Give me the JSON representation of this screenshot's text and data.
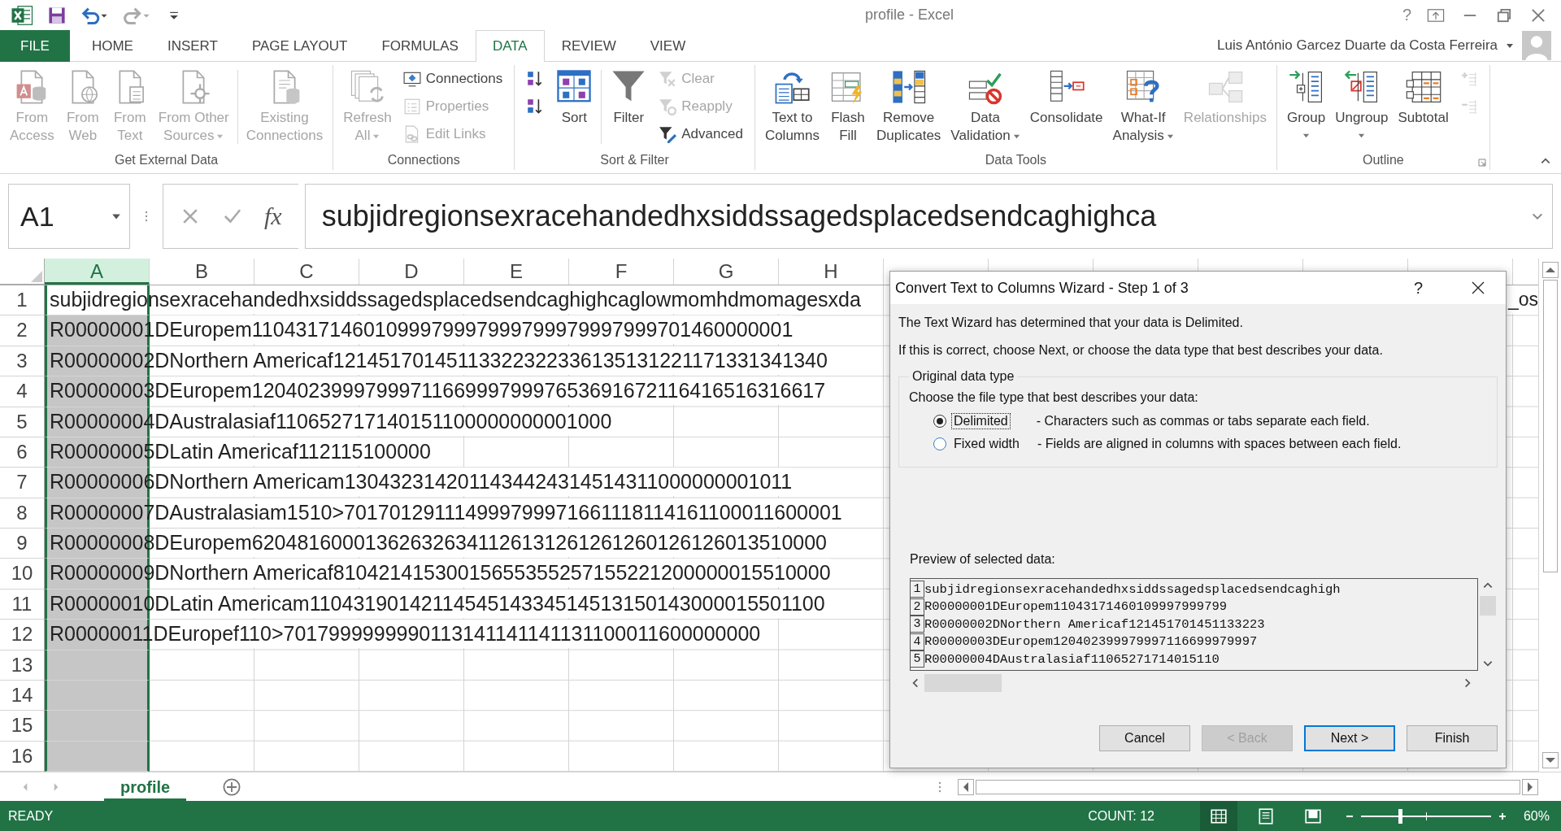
{
  "title_bar": {
    "title": "profile - Excel",
    "help": "?"
  },
  "tabs": [
    {
      "label": "FILE",
      "kind": "file",
      "selected": false
    },
    {
      "label": "HOME",
      "kind": "tab",
      "selected": false
    },
    {
      "label": "INSERT",
      "kind": "tab",
      "selected": false
    },
    {
      "label": "PAGE LAYOUT",
      "kind": "tab",
      "selected": false
    },
    {
      "label": "FORMULAS",
      "kind": "tab",
      "selected": false
    },
    {
      "label": "DATA",
      "kind": "tab",
      "selected": true
    },
    {
      "label": "REVIEW",
      "kind": "tab",
      "selected": false
    },
    {
      "label": "VIEW",
      "kind": "tab",
      "selected": false
    }
  ],
  "account": {
    "name": "Luis António Garcez Duarte da Costa Ferreira"
  },
  "ribbon": {
    "groups": [
      {
        "label": "Get External Data",
        "items": [
          {
            "kind": "large",
            "lines": [
              "From",
              "Access"
            ],
            "disabled": true,
            "dropdown": false
          },
          {
            "kind": "large",
            "lines": [
              "From",
              "Web"
            ],
            "disabled": true,
            "dropdown": false
          },
          {
            "kind": "large",
            "lines": [
              "From",
              "Text"
            ],
            "disabled": true,
            "dropdown": false
          },
          {
            "kind": "large",
            "lines": [
              "From Other",
              "Sources"
            ],
            "disabled": true,
            "dropdown": true
          },
          {
            "kind": "separator"
          },
          {
            "kind": "large",
            "lines": [
              "Existing",
              "Connections"
            ],
            "disabled": true,
            "dropdown": false
          }
        ]
      },
      {
        "label": "Connections",
        "items": [
          {
            "kind": "large",
            "lines": [
              "Refresh",
              "All"
            ],
            "disabled": true,
            "dropdown": true
          },
          {
            "kind": "column",
            "items": [
              {
                "label": "Connections",
                "disabled": false
              },
              {
                "label": "Properties",
                "disabled": true
              },
              {
                "label": "Edit Links",
                "disabled": true
              }
            ]
          }
        ]
      },
      {
        "label": "Sort & Filter",
        "items": [
          {
            "kind": "column",
            "items": [
              {
                "disabled": false
              },
              {
                "disabled": false
              }
            ]
          },
          {
            "kind": "large",
            "lines": [
              "Sort"
            ],
            "disabled": false,
            "dropdown": false
          },
          {
            "kind": "separator"
          },
          {
            "kind": "large",
            "lines": [
              "Filter"
            ],
            "disabled": false,
            "dropdown": false
          },
          {
            "kind": "column",
            "items": [
              {
                "label": "Clear",
                "disabled": true
              },
              {
                "label": "Reapply",
                "disabled": true
              },
              {
                "label": "Advanced",
                "disabled": false
              }
            ]
          }
        ]
      },
      {
        "label": "Data Tools",
        "items": [
          {
            "kind": "large",
            "lines": [
              "Text to",
              "Columns"
            ],
            "disabled": false,
            "dropdown": false
          },
          {
            "kind": "large",
            "lines": [
              "Flash",
              "Fill"
            ],
            "disabled": false,
            "dropdown": false
          },
          {
            "kind": "large",
            "lines": [
              "Remove",
              "Duplicates"
            ],
            "disabled": false,
            "dropdown": false
          },
          {
            "kind": "large",
            "lines": [
              "Data",
              "Validation"
            ],
            "disabled": false,
            "dropdown": true
          },
          {
            "kind": "large",
            "lines": [
              "Consolidate"
            ],
            "disabled": false,
            "dropdown": false
          },
          {
            "kind": "large",
            "lines": [
              "What-If",
              "Analysis"
            ],
            "disabled": false,
            "dropdown": true
          },
          {
            "kind": "large",
            "lines": [
              "Relationships"
            ],
            "disabled": true,
            "dropdown": false
          }
        ]
      },
      {
        "label": "Outline",
        "launcher": true,
        "items": [
          {
            "kind": "large",
            "lines": [
              "Group"
            ],
            "disabled": false,
            "dropdown": true
          },
          {
            "kind": "large",
            "lines": [
              "Ungroup"
            ],
            "disabled": false,
            "dropdown": true
          },
          {
            "kind": "large",
            "lines": [
              "Subtotal"
            ],
            "disabled": false,
            "dropdown": false
          },
          {
            "kind": "column",
            "items": [
              {
                "disabled": true
              },
              {
                "disabled": true
              }
            ]
          }
        ]
      }
    ]
  },
  "formula_bar": {
    "name_box": "A1",
    "function_label": "fx",
    "content": "subjidregionsexracehandedhxsiddssagedsplacedsendcaghighca"
  },
  "columns": [
    {
      "label": "A",
      "selected": true
    },
    {
      "label": "B",
      "selected": false
    },
    {
      "label": "C",
      "selected": false
    },
    {
      "label": "D",
      "selected": false
    },
    {
      "label": "E",
      "selected": false
    },
    {
      "label": "F",
      "selected": false
    },
    {
      "label": "G",
      "selected": false
    },
    {
      "label": "H",
      "selected": false
    }
  ],
  "rows": [
    {
      "number": "1",
      "text": "subjidregionsexracehandedhxsiddssagedsplacedsendcaghighcaglowmomhdmomagesxda",
      "tail": "_os"
    },
    {
      "number": "2",
      "text": "R00000001DEuropem110431714601099979997999799979997999701460000001"
    },
    {
      "number": "3",
      "text": "R00000002DNorthern Americaf12145170145113322322336135131221171331341340"
    },
    {
      "number": "4",
      "text": "R00000003DEuropem120402399979997116699979997653691672116416516316617"
    },
    {
      "number": "5",
      "text": "R00000004DAustralasiaf110652717140151100000000001000"
    },
    {
      "number": "6",
      "text": "R00000005DLatin Americaf112115100000"
    },
    {
      "number": "7",
      "text": "R00000006DNorthern Americam1304323142011434424314514311000000001011"
    },
    {
      "number": "8",
      "text": "R00000007DAustralasiam1510>701701291114999799971661118114161100011600001"
    },
    {
      "number": "9",
      "text": "R00000008DEuropem620481600013626326341126131261261260126126013510000"
    },
    {
      "number": "10",
      "text": "R00000009DNorthern Americaf81042141530015655355257155221200000015510000"
    },
    {
      "number": "11",
      "text": "R00000010DLatin Americam1104319014211454514334514513150143000015501100"
    },
    {
      "number": "12",
      "text": "R00000011DEuropef110>7017999999990113141141141131100011600000000"
    },
    {
      "number": "13"
    },
    {
      "number": "14"
    },
    {
      "number": "15"
    },
    {
      "number": "16"
    }
  ],
  "sheets": [
    {
      "label": "profile",
      "selected": true
    }
  ],
  "status_bar": {
    "mode": "READY",
    "count": "COUNT: 12",
    "views": [
      {
        "selected": true
      },
      {
        "selected": false
      },
      {
        "selected": false
      }
    ],
    "zoom": {
      "level": 0.3,
      "reading": "60%"
    }
  },
  "dialog": {
    "title": "Convert Text to Columns Wizard - Step 1 of 3",
    "help": "?",
    "intro": [
      "The Text Wizard has determined that your data is Delimited.",
      "If this is correct, choose Next, or choose the data type that best describes your data."
    ],
    "group_title": "Original data type",
    "prompt": "Choose the file type that best describes your data:",
    "options": [
      {
        "label": "Delimited",
        "description": "- Characters such as commas or tabs separate each field.",
        "selected": true
      },
      {
        "label": "Fixed width",
        "description": "- Fields are aligned in columns with spaces between each field.",
        "selected": false
      }
    ],
    "preview_label": "Preview of selected data:",
    "preview_lines": [
      {
        "number": "1",
        "text": "subjidregionsexracehandedhxsiddssagedsplacedsendcaghigh"
      },
      {
        "number": "2",
        "text": "R00000001DEuropem11043171460109997999799"
      },
      {
        "number": "3",
        "text": "R00000002DNorthern Americaf121451701451133223"
      },
      {
        "number": "4",
        "text": "R00000003DEuropem120402399979997116699979997"
      },
      {
        "number": "5",
        "text": "R00000004DAustralasiaf11065271714015110"
      }
    ],
    "buttons": [
      {
        "label": "Cancel",
        "disabled": false,
        "default": false
      },
      {
        "label": "< Back",
        "disabled": true,
        "default": false
      },
      {
        "label": "Next >",
        "disabled": false,
        "default": true
      },
      {
        "label": "Finish",
        "disabled": false,
        "default": false
      }
    ]
  }
}
